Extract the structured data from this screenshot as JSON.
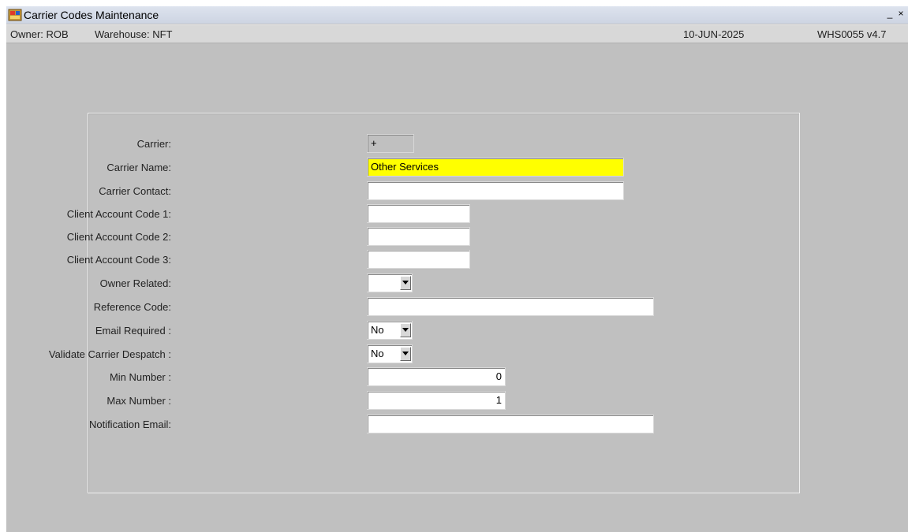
{
  "window": {
    "title": "Carrier Codes Maintenance",
    "minimize_symbol": "_",
    "close_symbol": "×",
    "icon": "oracle-forms-app-icon"
  },
  "infobar": {
    "owner": "Owner:  ROB",
    "warehouse": "Warehouse:  NFT",
    "date": "10-JUN-2025",
    "version": "WHS0055  v4.7"
  },
  "form": {
    "carrier": {
      "label": "Carrier:",
      "value": "+"
    },
    "carrier_name": {
      "label": "Carrier Name:",
      "value": "Other Services"
    },
    "carrier_contact": {
      "label": "Carrier Contact:",
      "value": ""
    },
    "client_account_code_1": {
      "label": "Client Account Code 1:",
      "value": ""
    },
    "client_account_code_2": {
      "label": "Client Account Code 2:",
      "value": ""
    },
    "client_account_code_3": {
      "label": "Client Account Code 3:",
      "value": ""
    },
    "owner_related": {
      "label": "Owner Related:",
      "value": ""
    },
    "reference_code": {
      "label": "Reference Code:",
      "value": ""
    },
    "email_required": {
      "label": "Email Required :",
      "value": "No"
    },
    "validate_carrier_despatch": {
      "label": "Validate Carrier Despatch :",
      "value": "No"
    },
    "min_number": {
      "label": "Min Number :",
      "value": "0"
    },
    "max_number": {
      "label": "Max Number :",
      "value": "1"
    },
    "notification_email": {
      "label": "Notification Email:",
      "value": ""
    }
  },
  "colors": {
    "window_bg": "#c0c0c0",
    "highlight_field": "#ffff00",
    "field_bg": "#ffffff"
  }
}
